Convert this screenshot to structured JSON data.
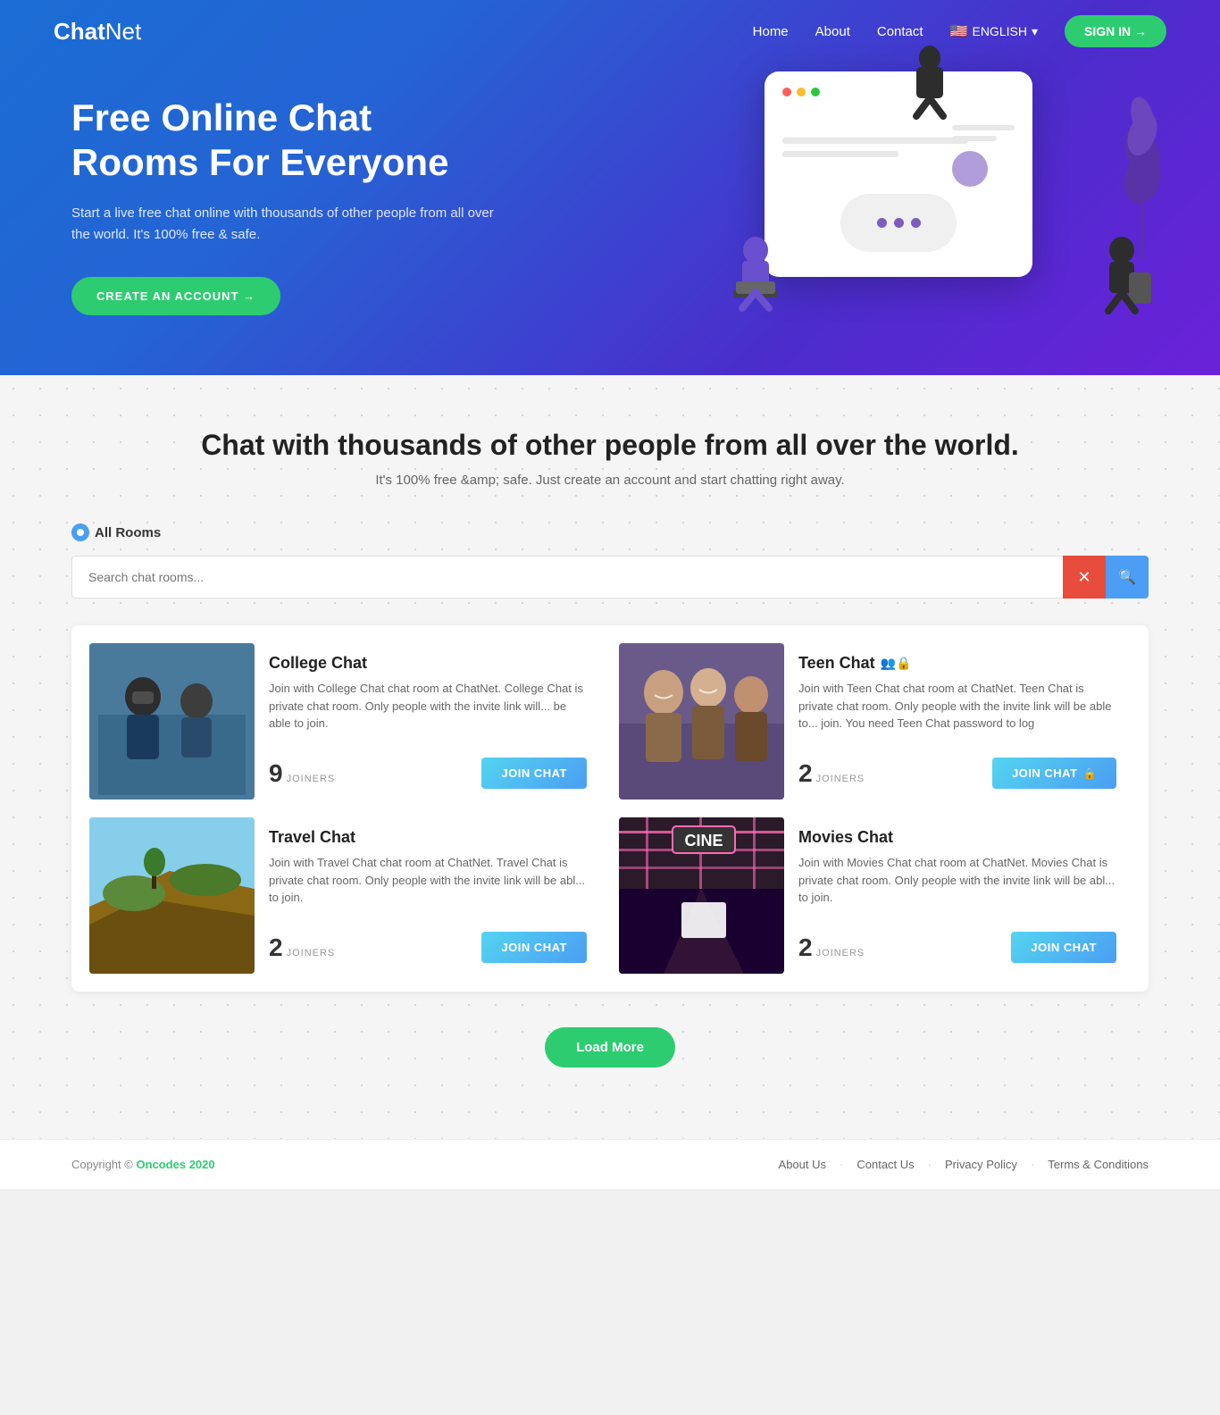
{
  "brand": {
    "chat": "Chat",
    "net": "Net"
  },
  "navbar": {
    "links": [
      {
        "label": "Home",
        "href": "#"
      },
      {
        "label": "About",
        "href": "#"
      },
      {
        "label": "Contact",
        "href": "#"
      }
    ],
    "language": "ENGLISH",
    "signin_label": "SIGN IN →"
  },
  "hero": {
    "title": "Free Online Chat Rooms For Everyone",
    "subtitle": "Start a live free chat online with thousands of other people from all over the world. It's 100% free & safe.",
    "cta_label": "CREATE AN ACCOUNT →"
  },
  "section": {
    "heading": "Chat with thousands of other people from all over the world.",
    "subheading": "It's 100% free &amp; safe. Just create an account and start chatting right away.",
    "tab_all_rooms": "All Rooms",
    "search_placeholder": "Search chat rooms...",
    "search_clear": "✕",
    "search_icon": "🔍"
  },
  "rooms": [
    {
      "id": 1,
      "title": "College Chat",
      "description": "Join with College Chat chat room at ChatNet. College Chat is private chat room. Only people with the invite link will... be able to join.",
      "joiners": 9,
      "btn_label": "JOIN CHAT",
      "private": false,
      "bg_color": "#ccc",
      "image_desc": "students with VR goggles"
    },
    {
      "id": 2,
      "title": "Teen Chat",
      "description": "Join with Teen Chat chat room at ChatNet. Teen Chat is private chat room. Only people with the invite link will be able to... join. You need Teen Chat password to log",
      "joiners": 2,
      "btn_label": "JOIN CHAT",
      "private": true,
      "bg_color": "#b0c4de",
      "image_desc": "teenagers smiling"
    },
    {
      "id": 3,
      "title": "Travel Chat",
      "description": "Join with Travel Chat chat room at ChatNet. Travel Chat is private chat room. Only people with the invite link will be abl... to join.",
      "joiners": 2,
      "btn_label": "JOIN CHAT",
      "private": false,
      "bg_color": "#a0b090",
      "image_desc": "cliff landscape"
    },
    {
      "id": 4,
      "title": "Movies Chat",
      "description": "Join with Movies Chat chat room at ChatNet. Movies Chat is private chat room. Only people with the invite link will be abl... to join.",
      "joiners": 2,
      "btn_label": "JOIN CHAT",
      "private": false,
      "bg_color": "#c08080",
      "image_desc": "cinema neon"
    }
  ],
  "load_more_label": "Load More",
  "footer": {
    "copyright": "Copyright © ",
    "brand": "Oncodes 2020",
    "links": [
      {
        "label": "About Us",
        "href": "#"
      },
      {
        "label": "Contact Us",
        "href": "#"
      },
      {
        "label": "Privacy Policy",
        "href": "#"
      },
      {
        "label": "Terms & Conditions",
        "href": "#"
      }
    ]
  }
}
